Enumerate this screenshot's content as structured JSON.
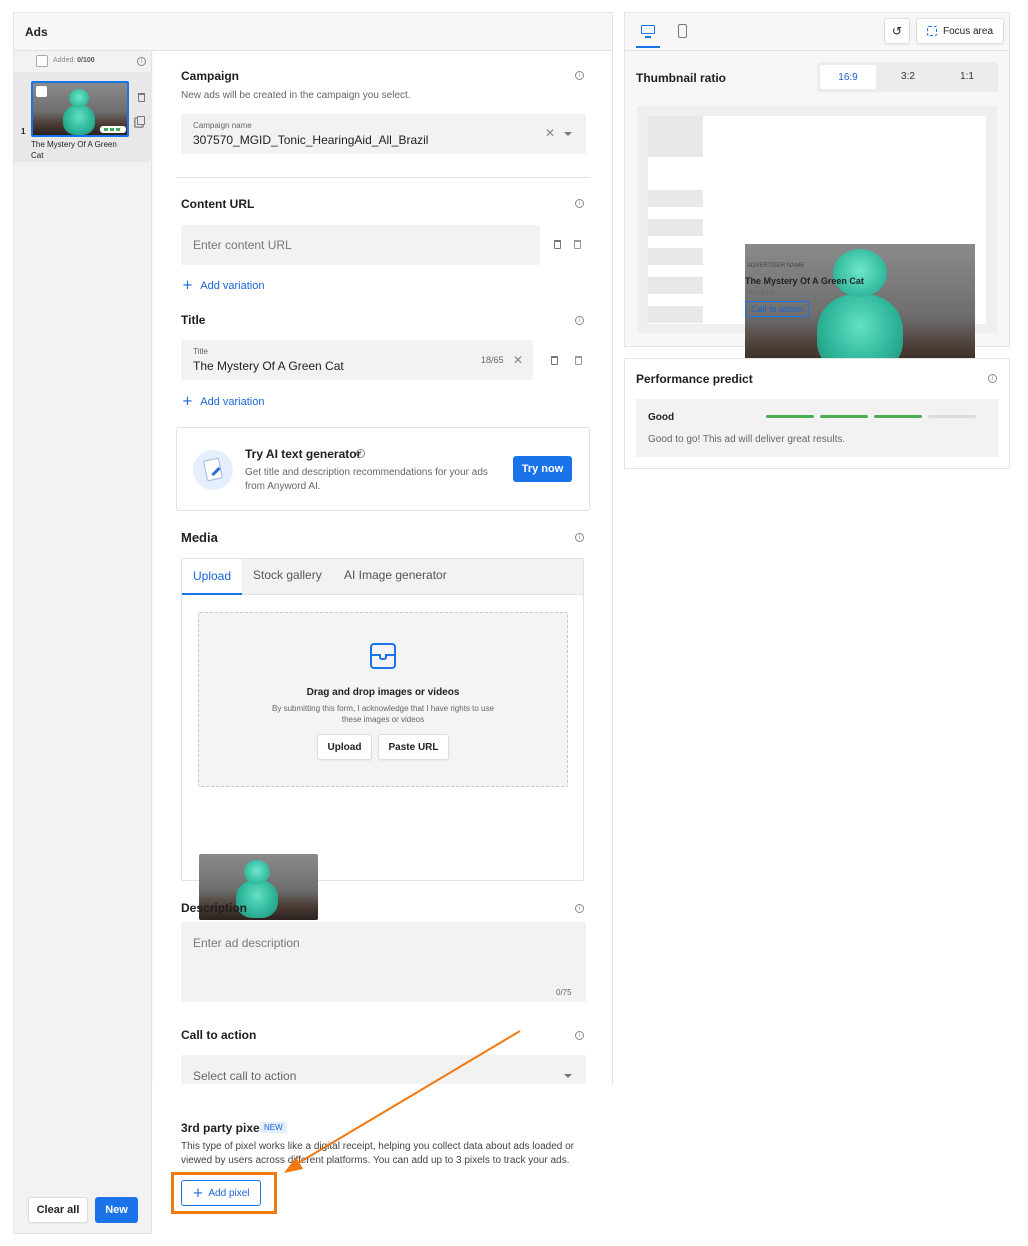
{
  "ads_panel": {
    "title": "Ads",
    "added_label": "Added:",
    "added_count": "0/100",
    "item_index": "1",
    "item_title": "The Mystery Of A Green Cat",
    "clear_all": "Clear all",
    "new": "New"
  },
  "campaign": {
    "label": "Campaign",
    "helper": "New ads will be created in the campaign you select.",
    "field_label": "Campaign name",
    "value": "307570_MGID_Tonic_HearingAid_All_Brazil"
  },
  "content_url": {
    "label": "Content URL",
    "placeholder": "Enter content URL",
    "add_variation": "Add variation"
  },
  "title_section": {
    "label": "Title",
    "field_label": "Title",
    "value": "The Mystery Of A Green Cat",
    "counter": "18/65",
    "add_variation": "Add variation"
  },
  "ai_text": {
    "title": "Try AI text generator",
    "description": "Get title and description recommendations for your ads from Anyword AI.",
    "button": "Try now"
  },
  "media": {
    "label": "Media",
    "tabs": [
      "Upload",
      "Stock gallery",
      "AI Image generator"
    ],
    "drop_title": "Drag and drop images or videos",
    "drop_note": "By submitting this form, I acknowledge that I have rights to use these images or videos",
    "upload_btn": "Upload",
    "paste_btn": "Paste URL"
  },
  "description": {
    "label": "Description",
    "placeholder": "Enter ad description",
    "counter": "0/75"
  },
  "cta": {
    "label": "Call to action",
    "placeholder": "Select call to action"
  },
  "pixel": {
    "label": "3rd party pixel",
    "badge": "NEW",
    "description": "This type of pixel works like a digital receipt, helping you collect data about ads loaded or viewed by users across different platforms. You can add up to 3 pixels to track your ads.",
    "button": "Add pixel"
  },
  "preview": {
    "focus_area": "Focus area",
    "thumbnail_ratio": "Thumbnail ratio",
    "ratios": [
      "16:9",
      "3:2",
      "1:1"
    ],
    "advertiser": "ADVERTISER NAME",
    "ad_title": "The Mystery Of A Green Cat",
    "ad_description": "Description",
    "cta": "Call to action"
  },
  "performance": {
    "title": "Performance predict",
    "rating": "Good",
    "message": "Good to go! This ad will deliver great results.",
    "score_fraction": 0.75
  },
  "colors": {
    "accent": "#1a73e8",
    "annotation": "#f07a10",
    "good": "#4caf50"
  }
}
